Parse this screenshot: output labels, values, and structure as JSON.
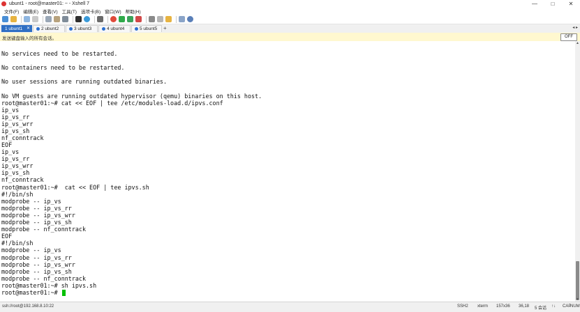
{
  "window": {
    "title": "ubunt1 - root@master01: ~ - Xshell 7",
    "controls": [
      "—",
      "□",
      "✕"
    ]
  },
  "menu": [
    "文件(F)",
    "编辑(E)",
    "查看(V)",
    "工具(T)",
    "选项卡(B)",
    "窗口(W)",
    "帮助(H)"
  ],
  "toolbar": {
    "icons": [
      "new-session-icon",
      "open-folder-icon",
      "reconnect-icon",
      "disconnect-icon",
      "copy-icon",
      "paste-icon",
      "find-icon",
      "terminal-icon",
      "globe-icon",
      "font-icon",
      "color-icon",
      "xftp-icon",
      "xmanager-icon",
      "transfer-icon",
      "lock-icon",
      "script-icon",
      "compose-icon",
      "layout-icon",
      "help-icon"
    ]
  },
  "tabs": [
    {
      "label": "1 ubunt1",
      "active": true
    },
    {
      "label": "2 ubunt2",
      "active": false
    },
    {
      "label": "3 ubunt3",
      "active": false
    },
    {
      "label": "4 ubunt4",
      "active": false
    },
    {
      "label": "5 ubunt5",
      "active": false
    }
  ],
  "tab_add": "+",
  "notice": {
    "text": "发送键盘输入的所有会话。",
    "button": "OFF"
  },
  "terminal": {
    "lines": [
      "",
      "No services need to be restarted.",
      "",
      "No containers need to be restarted.",
      "",
      "No user sessions are running outdated binaries.",
      "",
      "No VM guests are running outdated hypervisor (qemu) binaries on this host.",
      "root@master01:~# cat << EOF | tee /etc/modules-load.d/ipvs.conf",
      "ip_vs",
      "ip_vs_rr",
      "ip_vs_wrr",
      "ip_vs_sh",
      "nf_conntrack",
      "EOF",
      "ip_vs",
      "ip_vs_rr",
      "ip_vs_wrr",
      "ip_vs_sh",
      "nf_conntrack",
      "root@master01:~#  cat << EOF | tee ipvs.sh",
      "#!/bin/sh",
      "modprobe -- ip_vs",
      "modprobe -- ip_vs_rr",
      "modprobe -- ip_vs_wrr",
      "modprobe -- ip_vs_sh",
      "modprobe -- nf_conntrack",
      "EOF",
      "#!/bin/sh",
      "modprobe -- ip_vs",
      "modprobe -- ip_vs_rr",
      "modprobe -- ip_vs_wrr",
      "modprobe -- ip_vs_sh",
      "modprobe -- nf_conntrack",
      "root@master01:~# sh ipvs.sh",
      "root@master01:~# "
    ]
  },
  "status": {
    "connection": "ssh://root@192.168.8.10:22",
    "protocol": "SSH2",
    "terminal_type": "xterm",
    "size": "157x36",
    "cursor_pos": "36,18",
    "sessions": "5 会话",
    "caps": "CAP",
    "num": "NUM"
  }
}
